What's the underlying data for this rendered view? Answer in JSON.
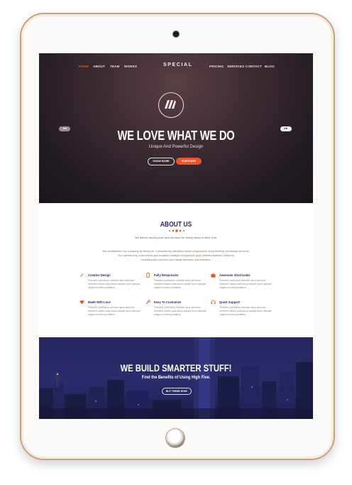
{
  "nav": {
    "left": [
      "HOME",
      "ABOUT",
      "TEAM",
      "WORKS"
    ],
    "right": [
      "PRICING",
      "SERVICES",
      "CONTACT",
      "BLOG"
    ],
    "logo": "SPECIAL"
  },
  "hero": {
    "title": "WE LOVE WHAT WE DO",
    "subtitle": "Unique And Powerful Design",
    "know_more": "KNOW MORE",
    "purchase": "PURCHASE",
    "prev": "◂◂",
    "next": "▸▸"
  },
  "about": {
    "title": "ABOUT US",
    "lead": "We deliver future-proof web services for timely ideas in New York.",
    "para_1": "We established our company at Newyork. Competently transition inside progressive back thinking functional services.",
    "para_2a": "Our partnership customized and enabled catalyst ",
    "para_2b": "exceptional goal",
    "para_2c": " oriented tactical platforms",
    "para_3": "revolutionary process and initiate dynamic communities."
  },
  "features": [
    {
      "title": "Creative Design",
      "icon": "rocket-icon"
    },
    {
      "title": "Fully Responsive",
      "icon": "mobile-icon"
    },
    {
      "title": "Awesome Shortcodes",
      "icon": "briefcase-icon"
    },
    {
      "title": "Made With Love",
      "icon": "heart-icon"
    },
    {
      "title": "Easy To Customize",
      "icon": "wrench-icon"
    },
    {
      "title": "Quick Support",
      "icon": "headset-icon"
    }
  ],
  "feature_text": "Praesent vestibulum molestie lacus aenenan hendrerit mauris polis lacus suscipit socio natoque magnis montes penatibus.",
  "cta": {
    "title": "WE BUILD SMARTER STUFF!",
    "subtitle": "Find the Benefits of Using High Five.",
    "button": "BUY THEME NOW!"
  },
  "colors": {
    "accent": "#e8552a",
    "navy": "#2b2a6e"
  }
}
